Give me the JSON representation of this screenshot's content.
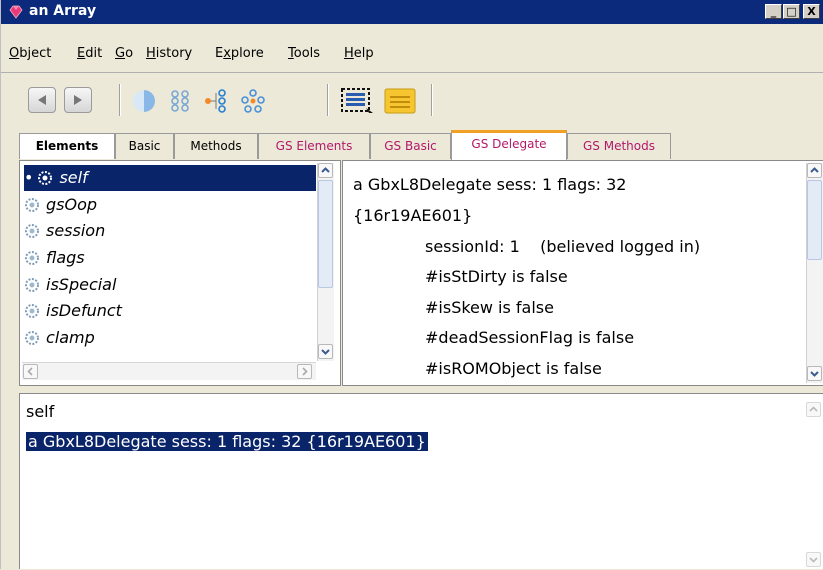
{
  "window": {
    "title": "an Array",
    "controls": {
      "minimize": "_",
      "maximize": "□",
      "close": "X"
    }
  },
  "menu": [
    {
      "label": "Object",
      "underline": "O"
    },
    {
      "label": "Edit",
      "underline": "E"
    },
    {
      "label": "Go",
      "underline": "G"
    },
    {
      "label": "History",
      "underline": "H"
    },
    {
      "label": "Explore",
      "underline": "x"
    },
    {
      "label": "Tools",
      "underline": "T"
    },
    {
      "label": "Help",
      "underline": "H"
    }
  ],
  "toolbar": {
    "icons": [
      "back-arrow-icon",
      "forward-arrow-icon",
      "half-circle-icon",
      "hierarchy-icon",
      "graph-icon",
      "network-icon",
      "select-list-icon",
      "notepad-icon"
    ]
  },
  "tabs": {
    "elements": "Elements",
    "basic": "Basic",
    "methods": "Methods",
    "gs_elements": "GS Elements",
    "gs_basic": "GS Basic",
    "gs_delegate": "GS Delegate",
    "gs_methods": "GS Methods"
  },
  "elements_list": [
    "self",
    "gsOop",
    "session",
    "flags",
    "isSpecial",
    "isDefunct",
    "clamp"
  ],
  "inspector": {
    "line1": "a GbxL8Delegate sess: 1 flags: 32",
    "line2": "{16r19AE601}",
    "line3": "sessionId: 1    (believed logged in)",
    "line4": "#isStDirty is false",
    "line5": "#isSkew is false",
    "line6": "#deadSessionFlag is false",
    "line7": "#isROMObject is false"
  },
  "workspace": {
    "line1": "self",
    "line2": "a GbxL8Delegate sess: 1 flags: 32 {16r19AE601}"
  },
  "colors": {
    "titlebar": "#0b2a7c",
    "selection": "#0a246a",
    "gs_tab_text": "#b3186a",
    "active_tab_accent": "#f0a024"
  }
}
